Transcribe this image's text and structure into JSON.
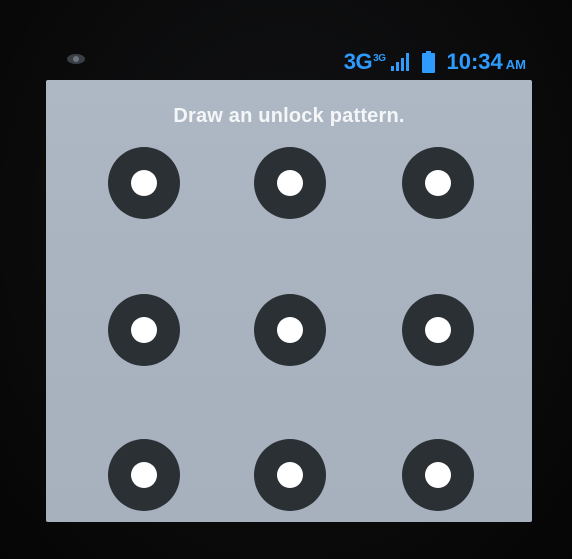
{
  "status_bar": {
    "network": "3G",
    "network_sup": "3G",
    "time": "10:34",
    "ampm": "AM",
    "accent_color": "#2e9bff",
    "icons": [
      "eye-icon",
      "signal-icon",
      "battery-icon"
    ]
  },
  "lock_screen": {
    "prompt": "Draw an unlock pattern.",
    "grid": {
      "rows": 3,
      "cols": 3
    },
    "dot_color": "#2b3035",
    "dot_center_color": "#ffffff",
    "background_color": "#aab4c0"
  }
}
